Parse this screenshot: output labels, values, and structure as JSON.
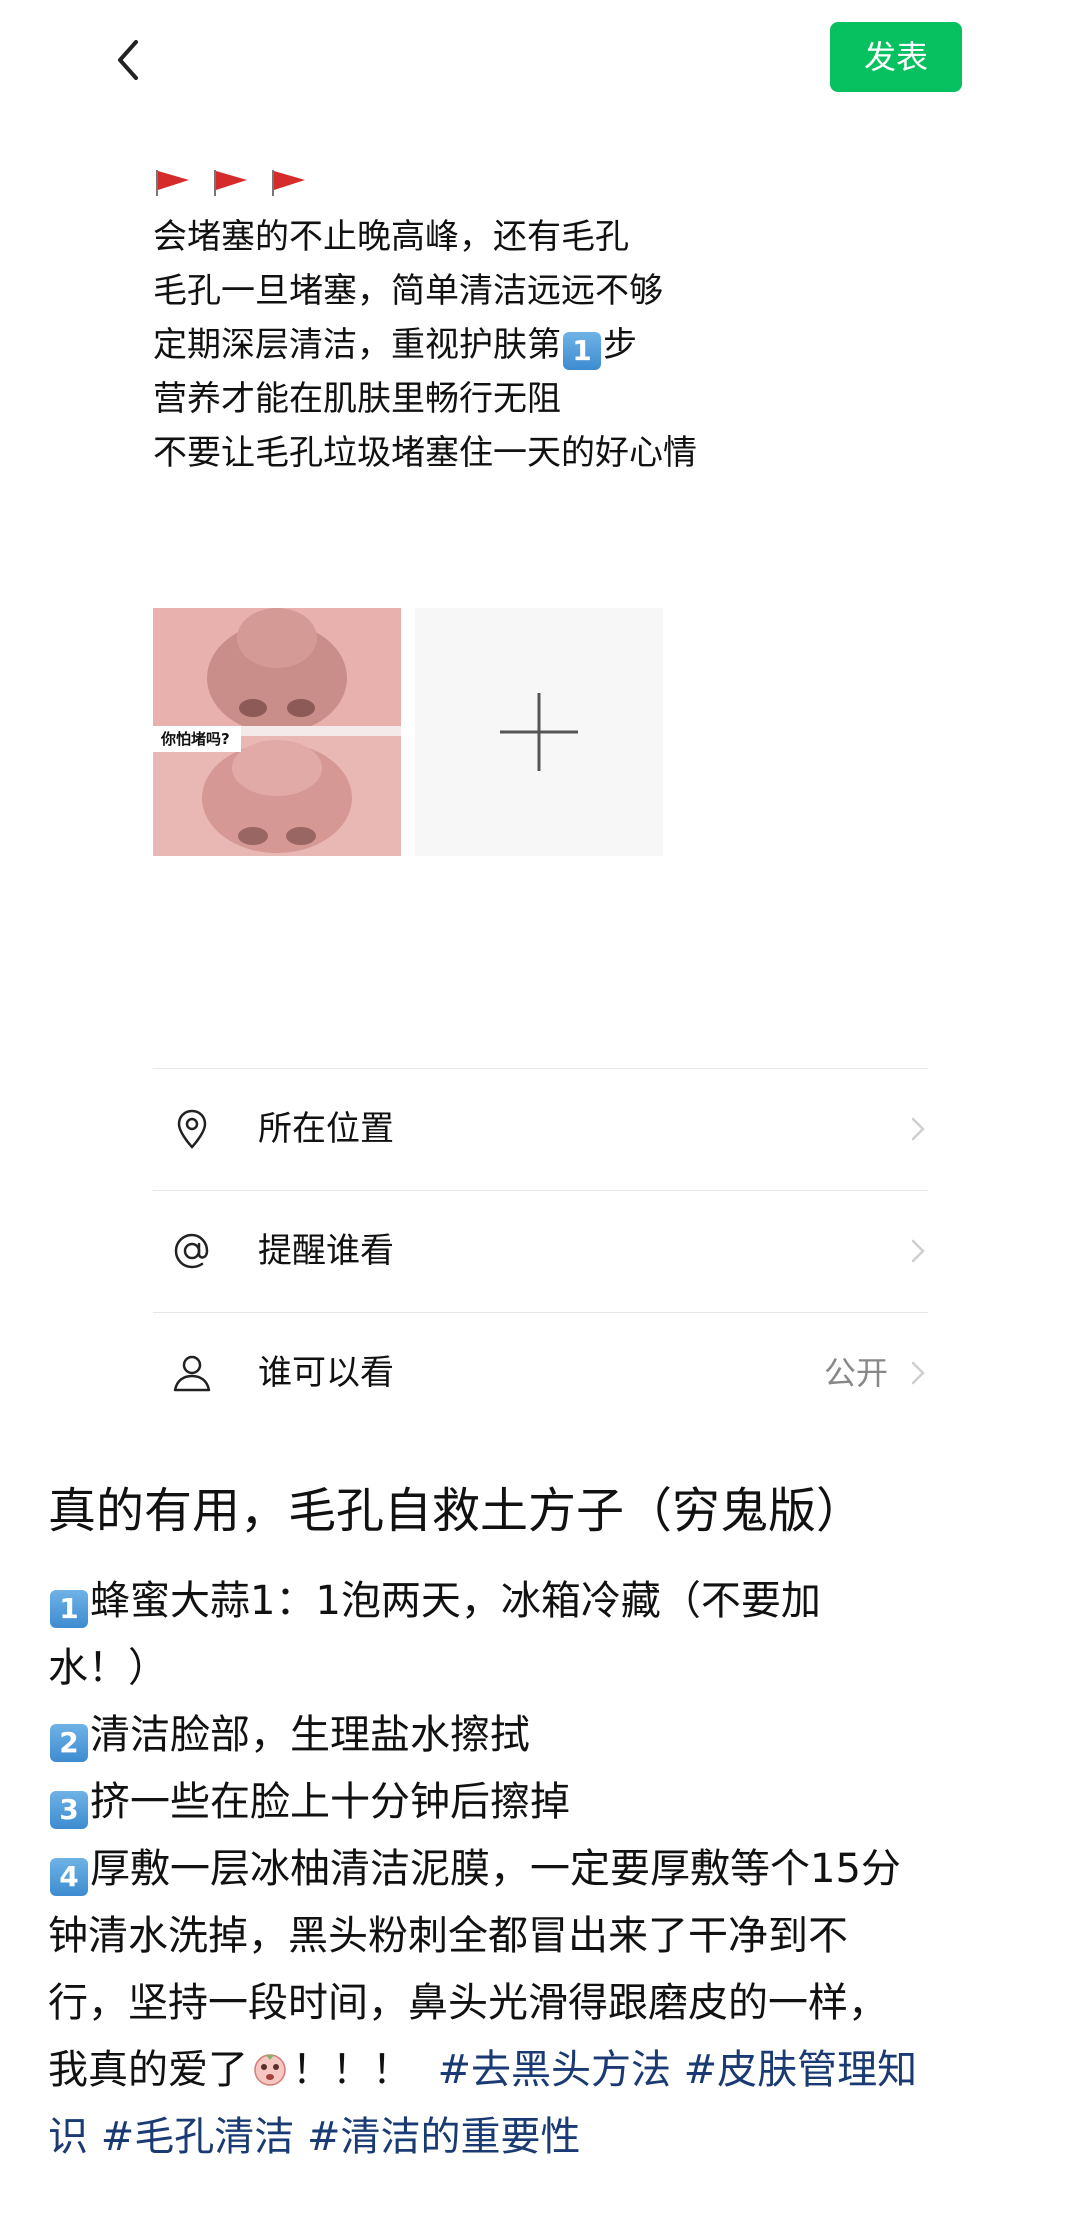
{
  "header": {
    "back_icon": "chevron-left-icon",
    "publish_label": "发表",
    "accent_color": "#07c160"
  },
  "post": {
    "flag_icon": "red-triangular-flag-icon",
    "lines": [
      {
        "text": "会堵塞的不止晚高峰，还有毛孔"
      },
      {
        "text": "毛孔一旦堵塞，简单清洁远远不够"
      },
      {
        "before": "定期深层清洁，重视护肤第",
        "badge": "1",
        "after": "步"
      },
      {
        "text": "营养才能在肌肤里畅行无阻"
      },
      {
        "text": "不要让毛孔垃圾堵塞住一天的好心情"
      }
    ],
    "image_label": "你怕堵吗?",
    "add_photo_icon": "plus-icon"
  },
  "options": [
    {
      "icon": "location-pin-icon",
      "label": "所在位置",
      "value": ""
    },
    {
      "icon": "at-sign-icon",
      "label": "提醒谁看",
      "value": ""
    },
    {
      "icon": "person-icon",
      "label": "谁可以看",
      "value": "公开"
    }
  ],
  "article": {
    "title": "真的有用，毛孔自救土方子（穷鬼版）",
    "lines": [
      {
        "badge": "1",
        "text": "蜂蜜大蒜1：1泡两天，冰箱冷藏（不要加"
      },
      {
        "badge": "",
        "text": "水！）"
      },
      {
        "badge": "2",
        "text": "清洁脸部，生理盐水擦拭"
      },
      {
        "badge": "3",
        "text": "挤一些在脸上十分钟后擦掉"
      },
      {
        "badge": "4",
        "text": "厚敷一层冰柚清洁泥膜，一定要厚敷等个15分"
      },
      {
        "badge": "",
        "text": "钟清水洗掉，黑头粉刺全都冒出来了干净到不"
      },
      {
        "badge": "",
        "text": "行，坚持一段时间，鼻头光滑得跟磨皮的一样，"
      }
    ],
    "last_line_text": "我真的爱了",
    "last_line_exclaim": "！！！",
    "tags_line1": "#去黑头方法 #皮肤管理知",
    "tags_line2_a": "识",
    "tags_line2_b": "#毛孔清洁 #清洁的重要性",
    "tag_color": "#1a3a73",
    "emoji_icon": "crying-face-emoji-icon"
  }
}
